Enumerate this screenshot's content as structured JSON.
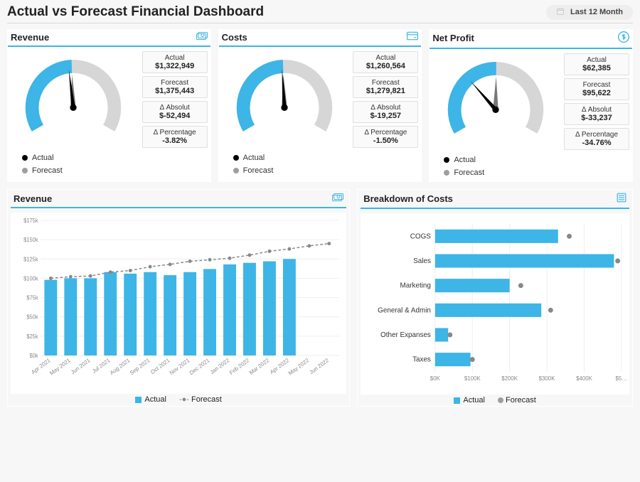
{
  "header": {
    "title": "Actual vs Forecast Financial Dashboard",
    "period_label": "Last 12 Month"
  },
  "colors": {
    "accent": "#3db5e6",
    "gray": "#9e9e9e",
    "black": "#000000"
  },
  "gauges": [
    {
      "key": "revenue",
      "title": "Revenue",
      "icon": "money-icon",
      "legend": {
        "actual": "Actual",
        "forecast": "Forecast"
      },
      "stats": {
        "actual_label": "Actual",
        "actual_value": "$1,322,949",
        "forecast_label": "Forecast",
        "forecast_value": "$1,375,443",
        "abs_label": "Δ Absolut",
        "abs_value": "$-52,494",
        "pct_label": "Δ Percentage",
        "pct_value": "-3.82%"
      }
    },
    {
      "key": "costs",
      "title": "Costs",
      "icon": "card-icon",
      "legend": {
        "actual": "Actual",
        "forecast": "Forecast"
      },
      "stats": {
        "actual_label": "Actual",
        "actual_value": "$1,260,564",
        "forecast_label": "Forecast",
        "forecast_value": "$1,279,821",
        "abs_label": "Δ Absolut",
        "abs_value": "$-19,257",
        "pct_label": "Δ Percentage",
        "pct_value": "-1.50%"
      }
    },
    {
      "key": "netprofit",
      "title": "Net Profit",
      "icon": "dollar-circle-icon",
      "legend": {
        "actual": "Actual",
        "forecast": "Forecast"
      },
      "stats": {
        "actual_label": "Actual",
        "actual_value": "$62,385",
        "forecast_label": "Forecast",
        "forecast_value": "$95,622",
        "abs_label": "Δ Absolut",
        "abs_value": "$-33,237",
        "pct_label": "Δ Percentage",
        "pct_value": "-34.76%"
      }
    }
  ],
  "revenue_panel": {
    "title": "Revenue",
    "icon": "money-icon",
    "legend": {
      "actual": "Actual",
      "forecast": "Forecast"
    }
  },
  "costs_panel": {
    "title": "Breakdown of Costs",
    "icon": "list-icon",
    "legend": {
      "actual": "Actual",
      "forecast": "Forecast"
    }
  },
  "chart_data": [
    {
      "type": "gauge",
      "title": "Revenue",
      "series": [
        {
          "name": "Actual",
          "value": 1322949
        },
        {
          "name": "Forecast",
          "value": 1375443
        }
      ],
      "max_implied": 2800000
    },
    {
      "type": "gauge",
      "title": "Costs",
      "series": [
        {
          "name": "Actual",
          "value": 1260564
        },
        {
          "name": "Forecast",
          "value": 1279821
        }
      ],
      "max_implied": 2600000
    },
    {
      "type": "gauge",
      "title": "Net Profit",
      "series": [
        {
          "name": "Actual",
          "value": 62385
        },
        {
          "name": "Forecast",
          "value": 95622
        }
      ],
      "max_implied": 190000
    },
    {
      "type": "bar",
      "title": "Revenue",
      "xlabel": "",
      "ylabel": "",
      "ylim": [
        0,
        175000
      ],
      "yticks": [
        "$0k",
        "$25k",
        "$50k",
        "$75k",
        "$100k",
        "$125k",
        "$150k",
        "$175k"
      ],
      "categories": [
        "Apr 2021",
        "May 2021",
        "Jun 2021",
        "Jul 2021",
        "Aug 2021",
        "Sep 2021",
        "Oct 2021",
        "Nov 2021",
        "Dec 2021",
        "Jan 2022",
        "Feb 2022",
        "Mar 2022",
        "Apr 2022",
        "May 2022",
        "Jun 2022"
      ],
      "series": [
        {
          "name": "Actual",
          "values": [
            98000,
            100000,
            100000,
            108000,
            106000,
            108000,
            104000,
            108000,
            112000,
            118000,
            120000,
            122000,
            125000,
            null,
            null
          ]
        },
        {
          "name": "Forecast",
          "values": [
            100000,
            102000,
            103000,
            108000,
            110000,
            115000,
            118000,
            122000,
            124000,
            126000,
            130000,
            135000,
            138000,
            142000,
            145000
          ]
        }
      ],
      "legend_position": "bottom"
    },
    {
      "type": "bar",
      "orientation": "horizontal",
      "title": "Breakdown of Costs",
      "xlabel": "",
      "ylabel": "",
      "xlim": [
        0,
        500000
      ],
      "xticks": [
        "$0K",
        "$100K",
        "$200K",
        "$300K",
        "$400K",
        "$5…"
      ],
      "categories": [
        "COGS",
        "Sales",
        "Marketing",
        "General & Admin",
        "Other Expanses",
        "Taxes"
      ],
      "series": [
        {
          "name": "Actual",
          "values": [
            330000,
            480000,
            200000,
            285000,
            35000,
            95000
          ]
        },
        {
          "name": "Forecast",
          "values": [
            360000,
            490000,
            230000,
            310000,
            40000,
            100000
          ]
        }
      ],
      "legend_position": "bottom"
    }
  ]
}
